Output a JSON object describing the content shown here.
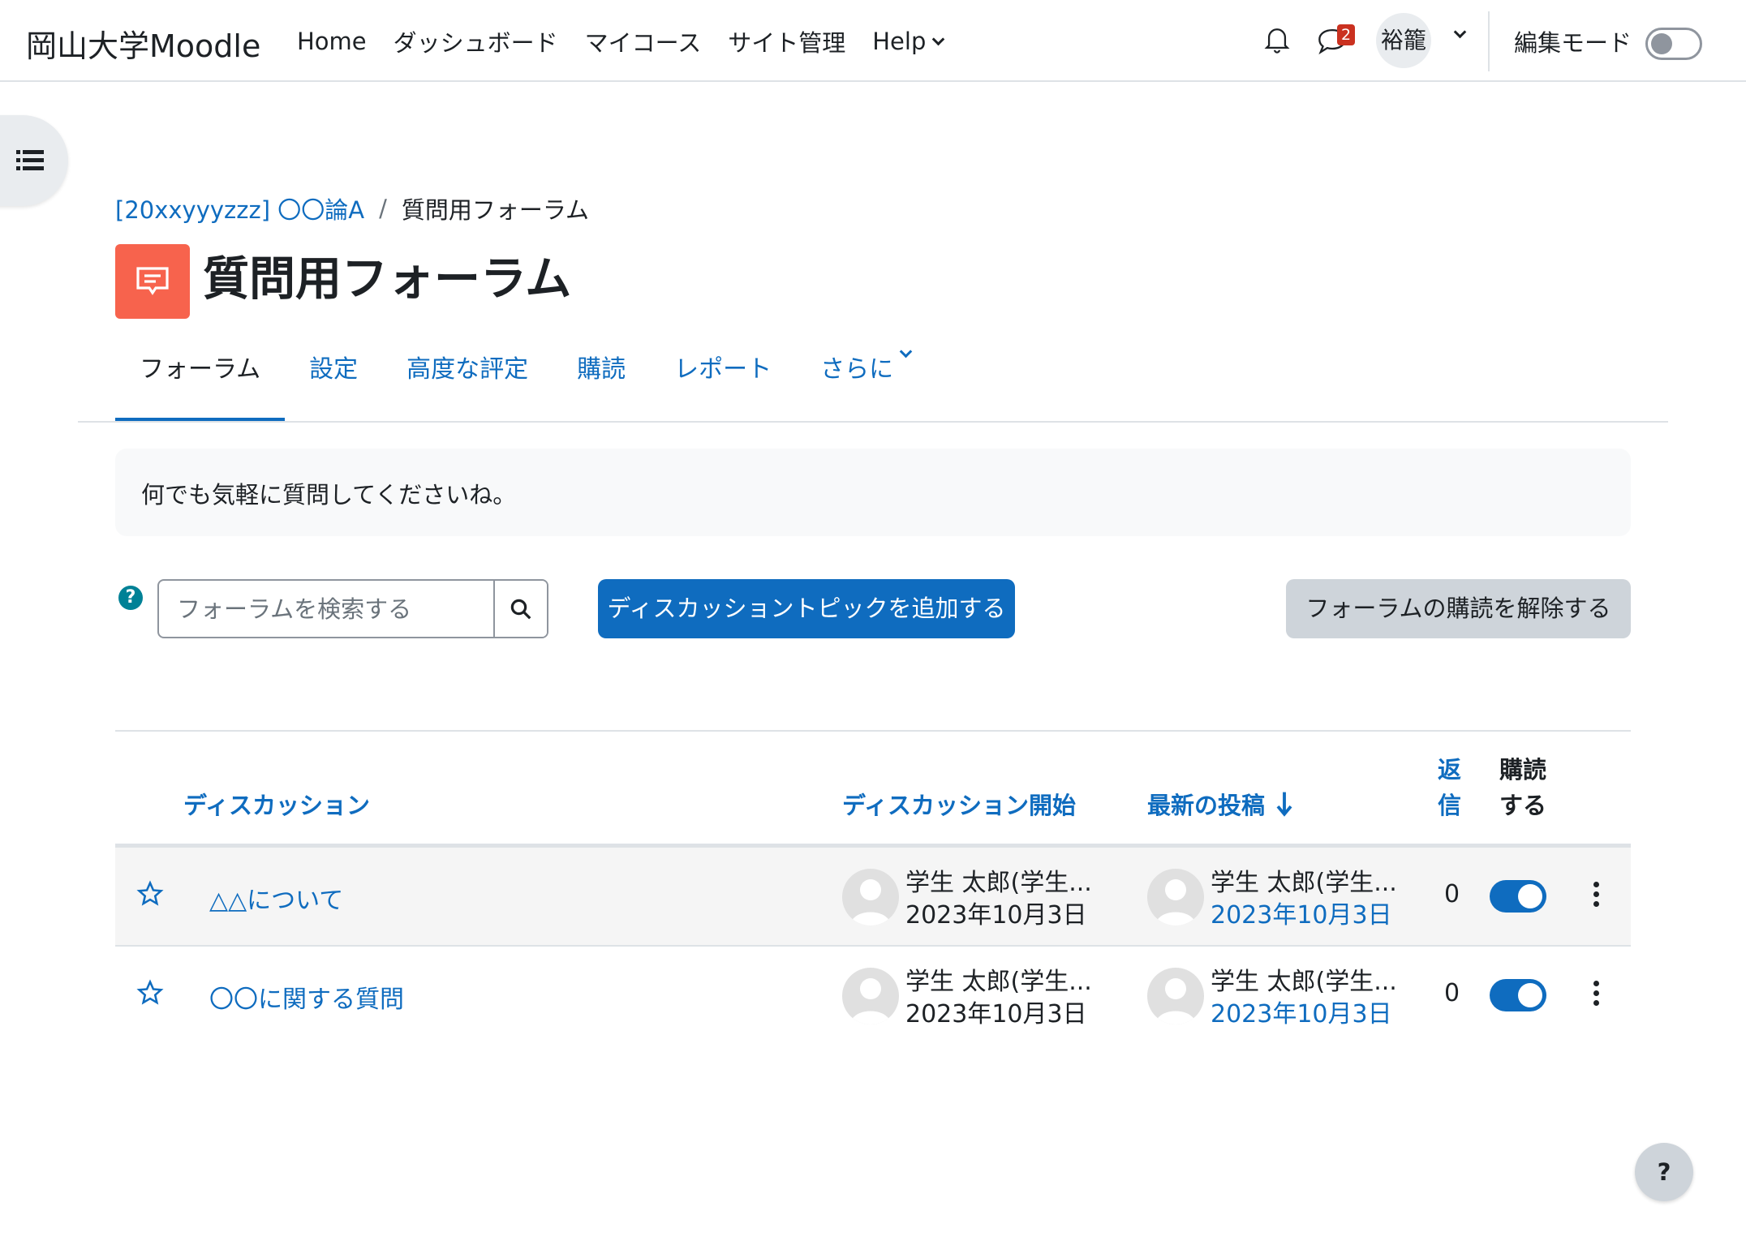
{
  "navbar": {
    "brand": "岡山大学Moodle",
    "links": [
      "Home",
      "ダッシュボード",
      "マイコース",
      "サイト管理",
      "Help"
    ],
    "message_count": "2",
    "user_initials": "裕籠",
    "edit_mode_label": "編集モード"
  },
  "breadcrumb": {
    "course": "[20xxyyyzzz] 〇〇論A",
    "separator": "/",
    "current": "質問用フォーラム"
  },
  "page": {
    "title": "質問用フォーラム",
    "icon_color": "#f7634d"
  },
  "tabs": [
    {
      "label": "フォーラム",
      "active": true
    },
    {
      "label": "設定"
    },
    {
      "label": "高度な評定"
    },
    {
      "label": "購読"
    },
    {
      "label": "レポート"
    },
    {
      "label": "さらに"
    }
  ],
  "intro": "何でも気軽に質問してくださいね。",
  "search": {
    "placeholder": "フォーラムを検索する"
  },
  "buttons": {
    "add_topic": "ディスカッショントピックを追加する",
    "unsubscribe": "フォーラムの購読を解除する"
  },
  "table": {
    "headers": {
      "discussion": "ディスカッション",
      "started_by": "ディスカッション開始",
      "last_post": "最新の投稿",
      "replies_line1": "返",
      "replies_line2": "信",
      "subscribe_line1": "購読",
      "subscribe_line2": "する"
    },
    "rows": [
      {
        "title": "△△について",
        "starter_name": "学生 太郎(学生...",
        "starter_date": "2023年10月3日",
        "last_name": "学生 太郎(学生...",
        "last_date": "2023年10月3日",
        "replies": "0",
        "subscribed": true
      },
      {
        "title": "〇〇に関する質問",
        "starter_name": "学生 太郎(学生...",
        "starter_date": "2023年10月3日",
        "last_name": "学生 太郎(学生...",
        "last_date": "2023年10月3日",
        "replies": "0",
        "subscribed": true
      }
    ]
  },
  "colors": {
    "primary": "#0f6cbf",
    "text": "#1d2125",
    "badge": "#ca3120"
  },
  "help_fab": "?"
}
